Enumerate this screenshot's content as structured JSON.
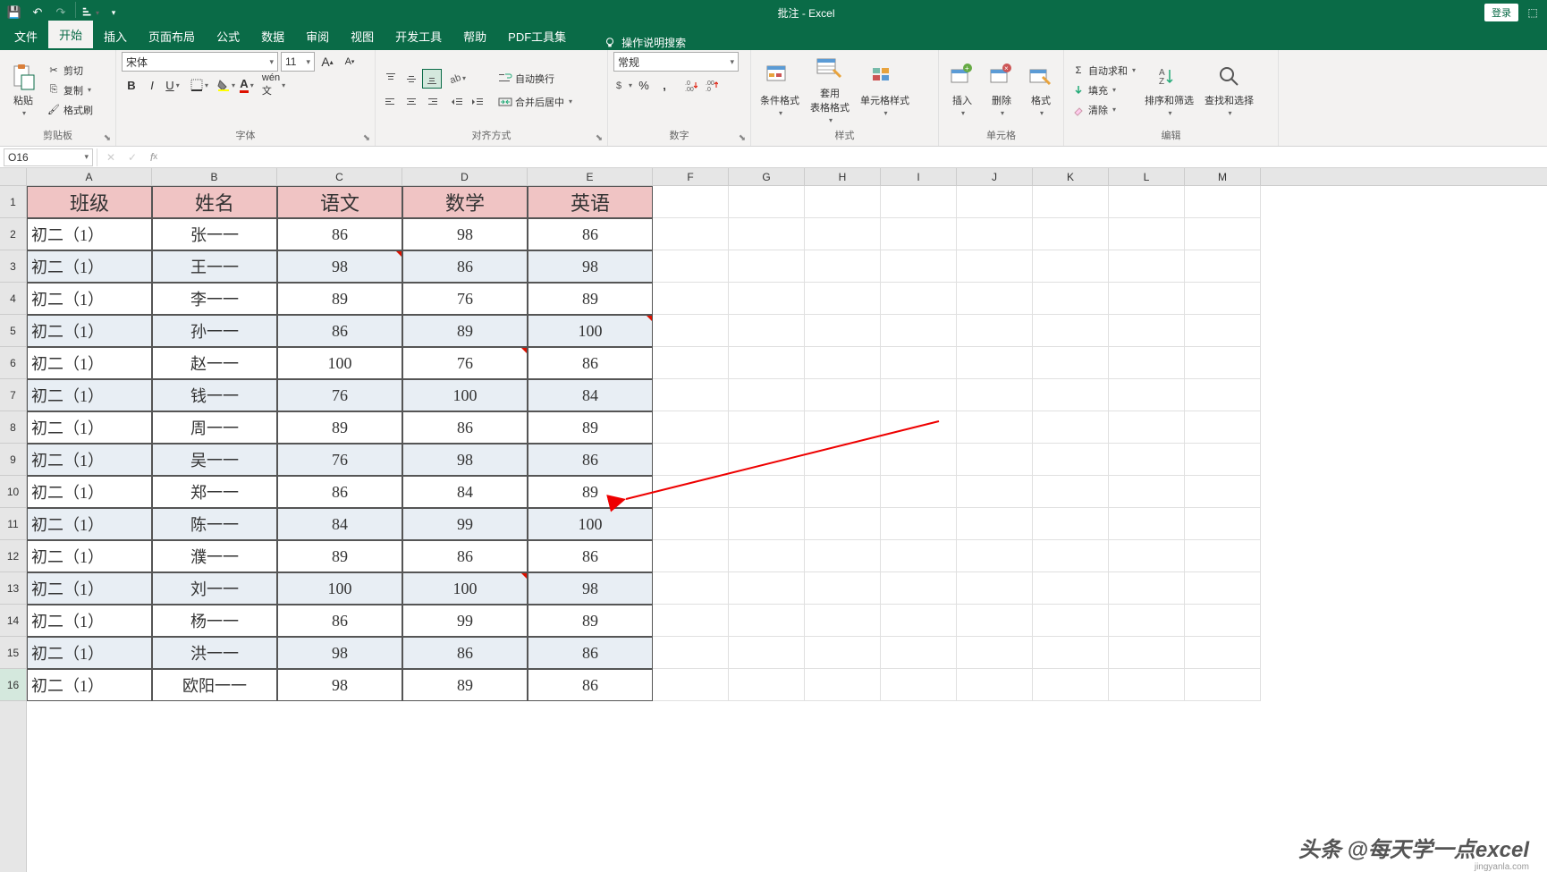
{
  "titlebar": {
    "title": "批注 - Excel",
    "login": "登录"
  },
  "tabs": {
    "file": "文件",
    "home": "开始",
    "insert": "插入",
    "layout": "页面布局",
    "formulas": "公式",
    "data": "数据",
    "review": "审阅",
    "view": "视图",
    "dev": "开发工具",
    "help": "帮助",
    "pdf": "PDF工具集",
    "tellme": "操作说明搜索"
  },
  "ribbon": {
    "clipboard": {
      "label": "剪贴板",
      "paste": "粘贴",
      "cut": "剪切",
      "copy": "复制",
      "painter": "格式刷"
    },
    "font": {
      "label": "字体",
      "name": "宋体",
      "size": "11"
    },
    "alignment": {
      "label": "对齐方式",
      "wrap": "自动换行",
      "merge": "合并后居中"
    },
    "number": {
      "label": "数字",
      "format": "常规"
    },
    "styles": {
      "label": "样式",
      "cond": "条件格式",
      "table": "套用\n表格格式",
      "cell": "单元格样式"
    },
    "cells": {
      "label": "单元格",
      "insert": "插入",
      "delete": "删除",
      "format": "格式"
    },
    "editing": {
      "label": "编辑",
      "sum": "自动求和",
      "fill": "填充",
      "clear": "清除",
      "sort": "排序和筛选",
      "find": "查找和选择"
    }
  },
  "formula": {
    "namebox": "O16"
  },
  "cols": [
    "A",
    "B",
    "C",
    "D",
    "E",
    "F",
    "G",
    "H",
    "I",
    "J",
    "K",
    "L",
    "M"
  ],
  "colw": {
    "data": 140,
    "blank": 80
  },
  "rowh": {
    "normal": 36
  },
  "headers": [
    "班级",
    "姓名",
    "语文",
    "数学",
    "英语"
  ],
  "sheet": [
    [
      "初二（1）",
      "张一一",
      "86",
      "98",
      "86"
    ],
    [
      "初二（1）",
      "王一一",
      "98",
      "86",
      "98"
    ],
    [
      "初二（1）",
      "李一一",
      "89",
      "76",
      "89"
    ],
    [
      "初二（1）",
      "孙一一",
      "86",
      "89",
      "100"
    ],
    [
      "初二（1）",
      "赵一一",
      "100",
      "76",
      "86"
    ],
    [
      "初二（1）",
      "钱一一",
      "76",
      "100",
      "84"
    ],
    [
      "初二（1）",
      "周一一",
      "89",
      "86",
      "89"
    ],
    [
      "初二（1）",
      "吴一一",
      "76",
      "98",
      "86"
    ],
    [
      "初二（1）",
      "郑一一",
      "86",
      "84",
      "89"
    ],
    [
      "初二（1）",
      "陈一一",
      "84",
      "99",
      "100"
    ],
    [
      "初二（1）",
      "濮一一",
      "89",
      "86",
      "86"
    ],
    [
      "初二（1）",
      "刘一一",
      "100",
      "100",
      "98"
    ],
    [
      "初二（1）",
      "杨一一",
      "86",
      "99",
      "89"
    ],
    [
      "初二（1）",
      "洪一一",
      "98",
      "86",
      "86"
    ],
    [
      "初二（1）",
      "欧阳一一",
      "98",
      "89",
      "86"
    ]
  ],
  "comments": [
    [
      2,
      3
    ],
    [
      4,
      5
    ],
    [
      5,
      4
    ],
    [
      12,
      4
    ]
  ],
  "watermark": "头条 @每天学一点excel",
  "watermark2": "jingyanla.com"
}
